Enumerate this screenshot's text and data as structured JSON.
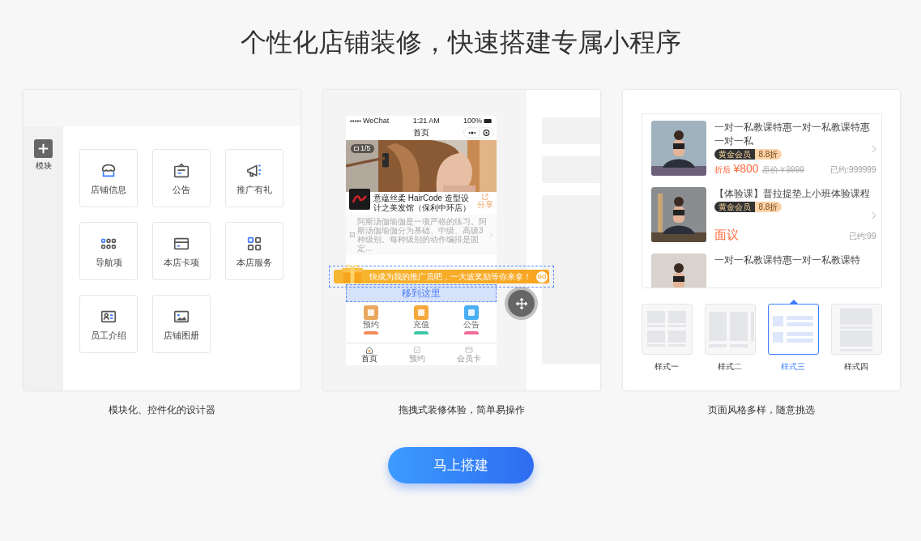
{
  "heading": "个性化店铺装修，快速搭建专属小程序",
  "designer_panel": {
    "sidebar_button": "模块",
    "modules": [
      {
        "label": "店铺信息"
      },
      {
        "label": "公告"
      },
      {
        "label": "推广有礼"
      },
      {
        "label": "导航项"
      },
      {
        "label": "本店卡项"
      },
      {
        "label": "本店服务"
      },
      {
        "label": "员工介绍"
      },
      {
        "label": "店铺图册"
      }
    ],
    "caption": "模块化、控件化的设计器"
  },
  "drag_panel": {
    "phone": {
      "status": {
        "carrier": "WeChat",
        "time": "1:21 AM",
        "battery": "100%"
      },
      "title": "首页",
      "photo_counter": "1/5",
      "store_name": "意蕴丝柔 HairCode 造型设计之美发馆（保利中环店）",
      "share": "分享",
      "description": "阿斯汤伽瑜伽是一项严格的练习。阿斯汤伽瑜伽分为基础、中级、高级3种级别。每种级别的动作编排是固定...",
      "drop_target": "移到这里",
      "shortcuts": [
        {
          "label": "预约"
        },
        {
          "label": "充值"
        },
        {
          "label": "公告"
        }
      ],
      "tab_bar": [
        {
          "label": "首页",
          "selected": true
        },
        {
          "label": "预约",
          "selected": false
        },
        {
          "label": "会员卡",
          "selected": false
        }
      ]
    },
    "promo_banner": {
      "text": "快成为我的推广员吧，一大波奖励等你来拿！",
      "go": "GO"
    },
    "caption": "拖拽式装修体验，简单易操作"
  },
  "style_panel": {
    "products": [
      {
        "title": "一对一私教课特惠一对一私教课特惠一对一私",
        "tags": [
          "黄金会员",
          "8.8折"
        ],
        "price_label": "折后",
        "price": "¥800",
        "original_price": "原价￥9999",
        "booked": "已约:999999"
      },
      {
        "title": "【体验课】普拉提垫上小班体验课程",
        "tags": [
          "黄金会员",
          "8.8折"
        ],
        "price": "面议",
        "booked": "已约:99"
      },
      {
        "title": "一对一私教课特惠一对一私教课特"
      }
    ],
    "styles": [
      {
        "label": "样式一",
        "selected": false
      },
      {
        "label": "样式二",
        "selected": false
      },
      {
        "label": "样式三",
        "selected": true
      },
      {
        "label": "样式四",
        "selected": false
      }
    ],
    "caption": "页面风格多样，随意挑选"
  },
  "cta_button": "马上搭建"
}
